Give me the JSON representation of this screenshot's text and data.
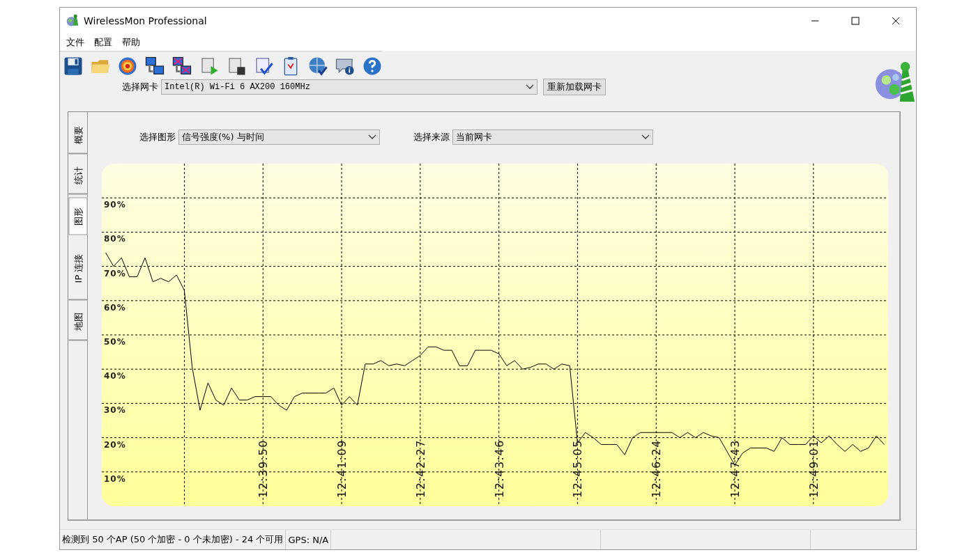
{
  "window": {
    "title": "WirelessMon Professional"
  },
  "menu": [
    {
      "label": "文件"
    },
    {
      "label": "配置"
    },
    {
      "label": "帮助"
    }
  ],
  "adapter": {
    "label": "选择网卡",
    "value": "Intel(R) Wi-Fi 6 AX200 160MHz",
    "button": "重新加载网卡"
  },
  "tabs": [
    {
      "label": "概要",
      "selected": false
    },
    {
      "label": "统计",
      "selected": false
    },
    {
      "label": "图形",
      "selected": true
    },
    {
      "label": "IP 连接",
      "selected": false
    },
    {
      "label": "地图",
      "selected": false
    }
  ],
  "graph_select": {
    "label": "选择图形",
    "value": "信号强度(%) 与时间"
  },
  "source_select": {
    "label": "选择来源",
    "value": "当前网卡"
  },
  "chart_data": {
    "type": "line",
    "grid": true,
    "ylim": [
      0,
      100
    ],
    "categories": [
      null,
      null,
      null,
      null,
      null,
      null,
      null,
      null,
      null,
      null,
      null,
      null,
      null,
      null,
      null,
      null,
      null,
      null,
      null,
      null,
      "12:39:50",
      null,
      null,
      null,
      null,
      null,
      null,
      null,
      null,
      null,
      "12:41:09",
      null,
      null,
      null,
      null,
      null,
      null,
      null,
      null,
      null,
      "12:42:27",
      null,
      null,
      null,
      null,
      null,
      null,
      null,
      null,
      null,
      "12:43:46",
      null,
      null,
      null,
      null,
      null,
      null,
      null,
      null,
      null,
      "12:45:05",
      null,
      null,
      null,
      null,
      null,
      null,
      null,
      null,
      null,
      "12:46:24",
      null,
      null,
      null,
      null,
      null,
      null,
      null,
      null,
      null,
      "12:47:43",
      null,
      null,
      null,
      null,
      null,
      null,
      null,
      null,
      null,
      "12:49:01",
      null,
      null,
      null,
      null,
      null,
      null,
      null,
      null,
      null
    ],
    "yticks": [
      {
        "value": 10,
        "label": "10%"
      },
      {
        "value": 20,
        "label": "20%"
      },
      {
        "value": 30,
        "label": "30%"
      },
      {
        "value": 40,
        "label": "40%"
      },
      {
        "value": 50,
        "label": "50%"
      },
      {
        "value": 60,
        "label": "60%"
      },
      {
        "value": 70,
        "label": "70%"
      },
      {
        "value": 80,
        "label": "80%"
      },
      {
        "value": 90,
        "label": "90%"
      }
    ],
    "values": [
      74,
      70,
      72.5,
      67,
      67,
      72.5,
      65.5,
      66.5,
      65.5,
      67.5,
      63,
      40.5,
      28,
      36,
      31,
      29.5,
      34.5,
      31,
      31,
      32,
      32,
      32,
      29.5,
      28,
      32,
      33,
      33,
      33,
      33,
      34.5,
      29.5,
      32,
      29.5,
      41.5,
      41.5,
      42.5,
      41,
      41.5,
      41,
      42.5,
      44,
      46.5,
      46.5,
      45.5,
      45.5,
      41,
      41,
      45.5,
      45.5,
      45.5,
      44.5,
      41,
      42.5,
      40,
      40.5,
      41.5,
      41.5,
      40,
      41.5,
      41,
      18.5,
      21.5,
      20,
      18,
      18,
      18,
      15,
      20,
      21.5,
      21.5,
      21.5,
      21.5,
      21.5,
      20,
      21.5,
      20,
      21.5,
      20.5,
      20,
      16,
      12,
      15.5,
      17,
      17,
      17,
      16,
      20,
      18,
      18,
      18,
      20.5,
      18.5,
      20.5,
      18,
      16,
      18,
      16,
      17,
      20.5,
      18
    ]
  },
  "status_bar": [
    {
      "text": "检测到 50 个AP (50 个加密 - 0 个未加密) - 24 个可用"
    },
    {
      "text": "GPS: N/A"
    }
  ]
}
